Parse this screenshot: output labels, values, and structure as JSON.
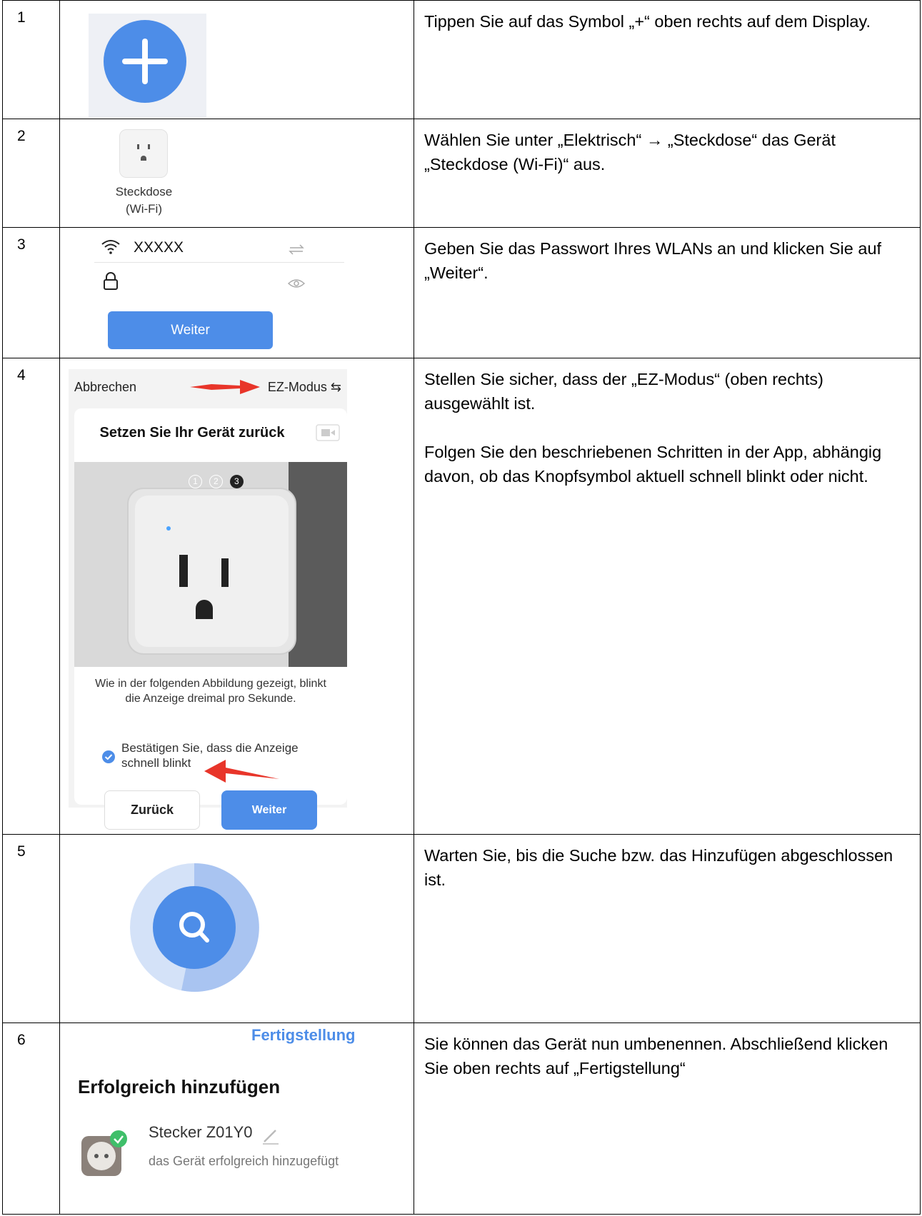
{
  "rows": [
    {
      "num": "1",
      "text": [
        "Tippen Sie auf das Symbol „+“ oben rechts auf dem Display."
      ]
    },
    {
      "num": "2",
      "text": [
        "Wählen Sie unter „Elektrisch“ → „Steckdose“ das Gerät „Steckdose (Wi-Fi)“ aus."
      ]
    },
    {
      "num": "3",
      "text": [
        "Geben Sie das Passwort Ihres WLANs an und klicken Sie auf „Weiter“."
      ]
    },
    {
      "num": "4",
      "text": [
        "Stellen Sie sicher, dass der „EZ-Modus“ (oben rechts) ausgewählt ist.",
        "Folgen Sie den beschriebenen Schritten in der App, abhängig davon, ob das Knopfsymbol aktuell schnell blinkt oder nicht."
      ]
    },
    {
      "num": "5",
      "text": [
        "Warten Sie, bis die Suche bzw. das Hinzufügen abgeschlossen ist."
      ]
    },
    {
      "num": "6",
      "text": [
        "Sie können das Gerät nun umbenennen. Abschließend klicken Sie oben rechts auf „Fertigstellung“"
      ]
    }
  ],
  "step2": {
    "caption_line1": "Steckdose",
    "caption_line2": "(Wi-Fi)"
  },
  "step3": {
    "ssid": "XXXXX",
    "button": "Weiter"
  },
  "step4": {
    "cancel": "Abbrechen",
    "mode": "EZ-Modus",
    "title": "Setzen Sie Ihr Gerät zurück",
    "step_indicators": [
      "1",
      "2",
      "3"
    ],
    "description": "Wie in der folgenden Abbildung gezeigt, blinkt die Anzeige dreimal pro Sekunde.",
    "confirm": "Bestätigen Sie, dass die Anzeige schnell blinkt",
    "back_button": "Zurück",
    "next_button": "Weiter"
  },
  "step6": {
    "done": "Fertigstellung",
    "heading": "Erfolgreich hinzufügen",
    "device_name": "Stecker Z01Y0",
    "device_status": "das Gerät erfolgreich hinzugefügt"
  },
  "colors": {
    "accent": "#4d8de8",
    "arrow": "#e8352a"
  }
}
